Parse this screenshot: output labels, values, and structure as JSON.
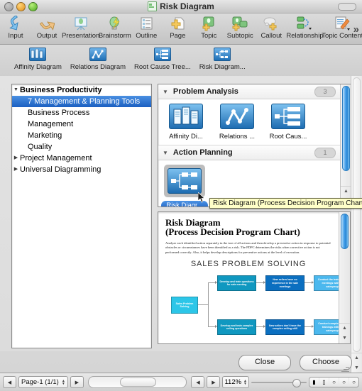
{
  "window": {
    "title": "Risk Diagram",
    "traffic_lights": [
      "close",
      "minimize",
      "zoom"
    ]
  },
  "toolbar": {
    "items": [
      {
        "label": "Input",
        "icon": "import-arrow-icon"
      },
      {
        "label": "Output",
        "icon": "export-arrow-icon"
      },
      {
        "label": "Presentation",
        "icon": "presentation-screen-icon"
      },
      {
        "label": "Brainstorm",
        "icon": "lightbulb-bolt-icon"
      },
      {
        "label": "Outline",
        "icon": "list-outline-icon"
      },
      {
        "label": "Page",
        "icon": "page-plus-icon"
      },
      {
        "label": "Topic",
        "icon": "topic-plus-icon"
      },
      {
        "label": "Subtopic",
        "icon": "subtopic-plus-icon"
      },
      {
        "label": "Callout",
        "icon": "callout-cloud-plus-icon"
      },
      {
        "label": "Relationship",
        "icon": "relationship-link-icon"
      },
      {
        "label": "Topic Content",
        "icon": "topic-content-pencil-icon"
      }
    ],
    "overflow_icon": "double-chevron-right-icon"
  },
  "toolbar2": {
    "items": [
      {
        "label": "Affinity Diagram",
        "icon": "affinity-diagram-icon"
      },
      {
        "label": "Relations Diagram",
        "icon": "relations-diagram-icon"
      },
      {
        "label": "Root Cause Tree...",
        "icon": "root-cause-tree-icon"
      },
      {
        "label": "Risk Diagram...",
        "icon": "risk-diagram-icon"
      }
    ]
  },
  "tree": {
    "nodes": [
      {
        "label": "Business Productivity",
        "level": 1,
        "state": "open",
        "selected": false
      },
      {
        "label": "7 Management & Planning Tools",
        "level": 2,
        "state": "none",
        "selected": true
      },
      {
        "label": "Business Process",
        "level": 2,
        "state": "none",
        "selected": false
      },
      {
        "label": "Management",
        "level": 2,
        "state": "none",
        "selected": false
      },
      {
        "label": "Marketing",
        "level": 2,
        "state": "none",
        "selected": false
      },
      {
        "label": "Quality",
        "level": 2,
        "state": "none",
        "selected": false
      },
      {
        "label": "Project Management",
        "level": 1,
        "state": "closed",
        "selected": false
      },
      {
        "label": "Universal Diagramming",
        "level": 1,
        "state": "closed",
        "selected": false
      }
    ]
  },
  "browser": {
    "groups": [
      {
        "name": "Problem Analysis",
        "count": "3",
        "expanded": true,
        "tiles": [
          {
            "caption": "Affinity Di...",
            "icon": "affinity-diagram-thumb",
            "selected": false
          },
          {
            "caption": "Relations ...",
            "icon": "relations-diagram-thumb",
            "selected": false
          },
          {
            "caption": "Root Caus...",
            "icon": "root-cause-tree-thumb",
            "selected": false
          }
        ]
      },
      {
        "name": "Action Planning",
        "count": "1",
        "expanded": true,
        "tiles": [
          {
            "caption": "Risk Diagr...",
            "icon": "risk-diagram-thumb",
            "selected": true
          }
        ]
      }
    ],
    "tooltip": "Risk Diagram (Process Decision Program Chart)"
  },
  "preview": {
    "heading_line1": "Risk Diagram",
    "heading_line2": "(Process Decision Program Chart)",
    "paragraph": "Analyze each identified action separately in the tree of all actions and then develop a preventive action in response to potential obstacles or circumstances have been identified as a risk. The PDPC determines the risks when corrective action is not performed correctly. Also, it helps develop descriptions for preventive actions at the level of execution.",
    "diagram_title": "SALES PROBLEM SOLVING",
    "diagram": {
      "root": {
        "text": "Sales Problem Solving",
        "color": "#2cc6e8"
      },
      "rows": [
        {
          "nodes": [
            {
              "text": "Develop and train questions for sale meeting",
              "color": "#1098c0"
            },
            {
              "text": "New sellers have no experience in the sale meetings",
              "color": "#0b6fc0"
            },
            {
              "text": "Conduct the training sale meetings with new salespeople",
              "color": "#4bb8ee"
            }
          ]
        },
        {
          "nodes": [
            {
              "text": "Develop and train complex selling questions",
              "color": "#1098c0"
            },
            {
              "text": "New sellers don't have the complex selling skill",
              "color": "#0b6fc0"
            },
            {
              "text": "Conduct complex selling trainings with new salespeople",
              "color": "#4bb8ee"
            }
          ]
        }
      ]
    }
  },
  "buttons": {
    "close": "Close",
    "choose": "Choose"
  },
  "statusbar": {
    "prev_icon": "left-triangle-icon",
    "page_label": "Page-1 (1/1)",
    "next_icon": "right-triangle-icon",
    "zoom_value": "112%",
    "hscroll_left_icon": "left-triangle-icon",
    "hscroll_right_icon": "right-triangle-icon"
  },
  "colors": {
    "selection_blue": "#1b5fc1",
    "tooltip_yellow": "#ffffc8",
    "tile_blue": "#1d6cb1"
  }
}
